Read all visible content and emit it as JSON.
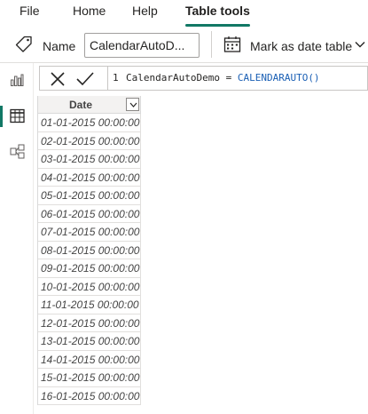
{
  "menu": {
    "tabs": [
      {
        "label": "File",
        "active": false
      },
      {
        "label": "Home",
        "active": false
      },
      {
        "label": "Help",
        "active": false
      },
      {
        "label": "Table tools",
        "active": true
      }
    ]
  },
  "toolbar": {
    "name_label": "Name",
    "name_value": "CalendarAutoD...",
    "mark_as_date_table_label": "Mark as date table",
    "icons": {
      "name": "tag-icon",
      "mark": "calendar-icon",
      "dropdown": "chevron-down-icon"
    }
  },
  "left_nav": {
    "items": [
      {
        "icon": "report-view-icon",
        "active": false
      },
      {
        "icon": "data-view-icon",
        "active": true
      },
      {
        "icon": "model-view-icon",
        "active": false
      }
    ]
  },
  "formula_bar": {
    "line_number": "1",
    "formula_name_part": "CalendarAutoDemo = ",
    "formula_function_part": "CALENDARAUTO()"
  },
  "table": {
    "column_header": "Date",
    "rows": [
      "01-01-2015 00:00:00",
      "02-01-2015 00:00:00",
      "03-01-2015 00:00:00",
      "04-01-2015 00:00:00",
      "05-01-2015 00:00:00",
      "06-01-2015 00:00:00",
      "07-01-2015 00:00:00",
      "08-01-2015 00:00:00",
      "09-01-2015 00:00:00",
      "10-01-2015 00:00:00",
      "11-01-2015 00:00:00",
      "12-01-2015 00:00:00",
      "13-01-2015 00:00:00",
      "14-01-2015 00:00:00",
      "15-01-2015 00:00:00",
      "16-01-2015 00:00:00"
    ]
  },
  "colors": {
    "accent": "#117865",
    "function_text": "#1a5fb4"
  }
}
